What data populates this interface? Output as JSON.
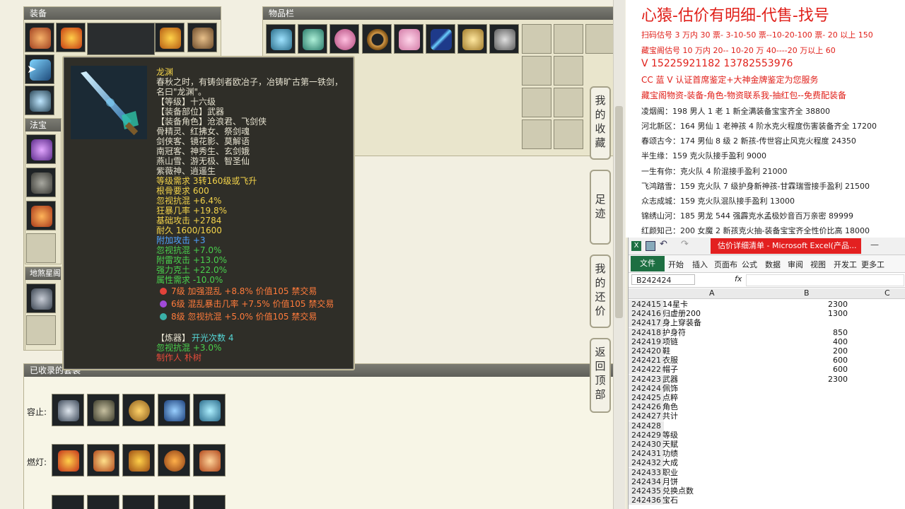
{
  "game": {
    "equip_title": "装备",
    "items_title": "物品栏",
    "fabao_title": "法宝",
    "dishaxing_title": "地煞星阁",
    "collected_title": "已收录的套装",
    "row1_label": "容止:",
    "row2_label": "燃灯:",
    "side_buttons": [
      "我的收藏",
      "足迹",
      "我的还价",
      "返回顶部"
    ]
  },
  "tooltip": {
    "name": "龙渊",
    "desc1": "春秋之时，有铸剑者欧冶子，冶铸旷古第一铁剑，",
    "desc2": "名曰\"龙渊\"。",
    "level": "【等级】十六级",
    "part": "【装备部位】武器",
    "roles1": "【装备角色】沧浪君、飞剑侠",
    "roles2": "骨精灵、红拂女、祭剑魂",
    "roles3": "剑侠客、镜花影、莫解语",
    "roles4": "南冠客、神秀生、玄剑娥",
    "roles5": "燕山雪、游无极、智圣仙",
    "roles6": "紫薇神、逍遥生",
    "req_level": "等级需求 3转160级或飞升",
    "req_bone": "根骨要求 600",
    "stat1": "忽视抗混 +6.4%",
    "stat2": "狂暴几率 +19.8%",
    "stat3": "基础攻击 +2784",
    "durability": "耐久 1600/1600",
    "extra_atk": "附加攻击 +3",
    "g1": "忽视抗混 +7.0%",
    "g2": "附雷攻击 +13.0%",
    "g3": "强力克土 +22.0%",
    "g4": "属性需求 -10.0%",
    "gem1": "7级 加强混乱 +8.8% 价值105 禁交易",
    "gem2": "6级 混乱暴击几率 +7.5% 价值105 禁交易",
    "gem3": "8级 忽视抗混 +5.0% 价值105 禁交易",
    "refine_label": "【炼器】",
    "refine_value": "开光次数 4",
    "refine_stat": "忽视抗混 +3.0%",
    "maker": "制作人 朴树"
  },
  "ad": {
    "headline": "心猿-估价有明细-代售-找号",
    "l1": "扫码估号 3 万内 30 票- 3-10-50 票--10-20-100 票- 20 以上 150",
    "l2": "藏宝阁估号 10 万内 20-- 10-20 万 40----20 万以上 60",
    "l3": "V 15225921182   13782553976",
    "l4": "CC 蓝 V 认证首席鉴定+大神金牌鉴定为您服务",
    "l5": "藏宝阁物资-装备-角色-物资联系我-抽红包--免费配装备",
    "l6": "凌烟阁：198 男人 1 老 1 新全满装备宝宝齐全 38800",
    "l7": "河北新区：164 男仙 1 老神孩 4 阶水克火程度伤害装备齐全 17200",
    "l8": "春颂古今：174 男仙 8 级 2 新孩-传世容止风克火程度 24350",
    "l9": "半生缘：159 克火队接手盈利 9000",
    "l10": "一生有你：克火队 4 阶混接手盈利 21000",
    "l11": "飞鸿踏雪：159 克火队 7 级护身新神孩-甘霖瑞雪接手盈利 21500",
    "l12": "众志成城：159 克火队混队接手盈利 13000",
    "l13": "锦绣山河：185 男龙 544 强霹克水孟极妙音百万亲密 89999",
    "l14": "红颜知己：200 女魔 2 新孩克火抽-装备宝宝齐全性价比高 18000"
  },
  "excel": {
    "title": "估价详细清单 - Microsoft Excel(产品...",
    "tabs": [
      "文件",
      "开始",
      "插入",
      "页面布",
      "公式",
      "数据",
      "审阅",
      "视图",
      "开发工",
      "更多工"
    ],
    "namebox": "B242424",
    "fx": "fx",
    "col_a": "A",
    "col_b": "B",
    "col_c": "C",
    "rows": [
      {
        "n": "242415",
        "a": "14星卡",
        "b": "2300"
      },
      {
        "n": "242416",
        "a": "归虚册200",
        "b": "1300"
      },
      {
        "n": "242417",
        "a": "身上穿装备",
        "b": ""
      },
      {
        "n": "242418",
        "a": "护身符",
        "b": "850"
      },
      {
        "n": "242419",
        "a": "项链",
        "b": "400"
      },
      {
        "n": "242420",
        "a": "鞋",
        "b": "200"
      },
      {
        "n": "242421",
        "a": "衣服",
        "b": "600"
      },
      {
        "n": "242422",
        "a": "帽子",
        "b": "600"
      },
      {
        "n": "242423",
        "a": "武器",
        "b": "2300"
      },
      {
        "n": "242424",
        "a": "佩饰",
        "b": ""
      },
      {
        "n": "242425",
        "a": "点粹",
        "b": ""
      },
      {
        "n": "242426",
        "a": "角色",
        "b": ""
      },
      {
        "n": "242427",
        "a": "共计",
        "b": ""
      },
      {
        "n": "242428",
        "a": "",
        "b": ""
      },
      {
        "n": "242429",
        "a": "等级",
        "b": ""
      },
      {
        "n": "242430",
        "a": "天赋",
        "b": ""
      },
      {
        "n": "242431",
        "a": "功绩",
        "b": ""
      },
      {
        "n": "242432",
        "a": "大成",
        "b": ""
      },
      {
        "n": "242433",
        "a": "职业",
        "b": ""
      },
      {
        "n": "242434",
        "a": "月饼",
        "b": ""
      },
      {
        "n": "242435",
        "a": "兑换点数",
        "b": ""
      },
      {
        "n": "242436",
        "a": "宝石",
        "b": ""
      }
    ]
  }
}
